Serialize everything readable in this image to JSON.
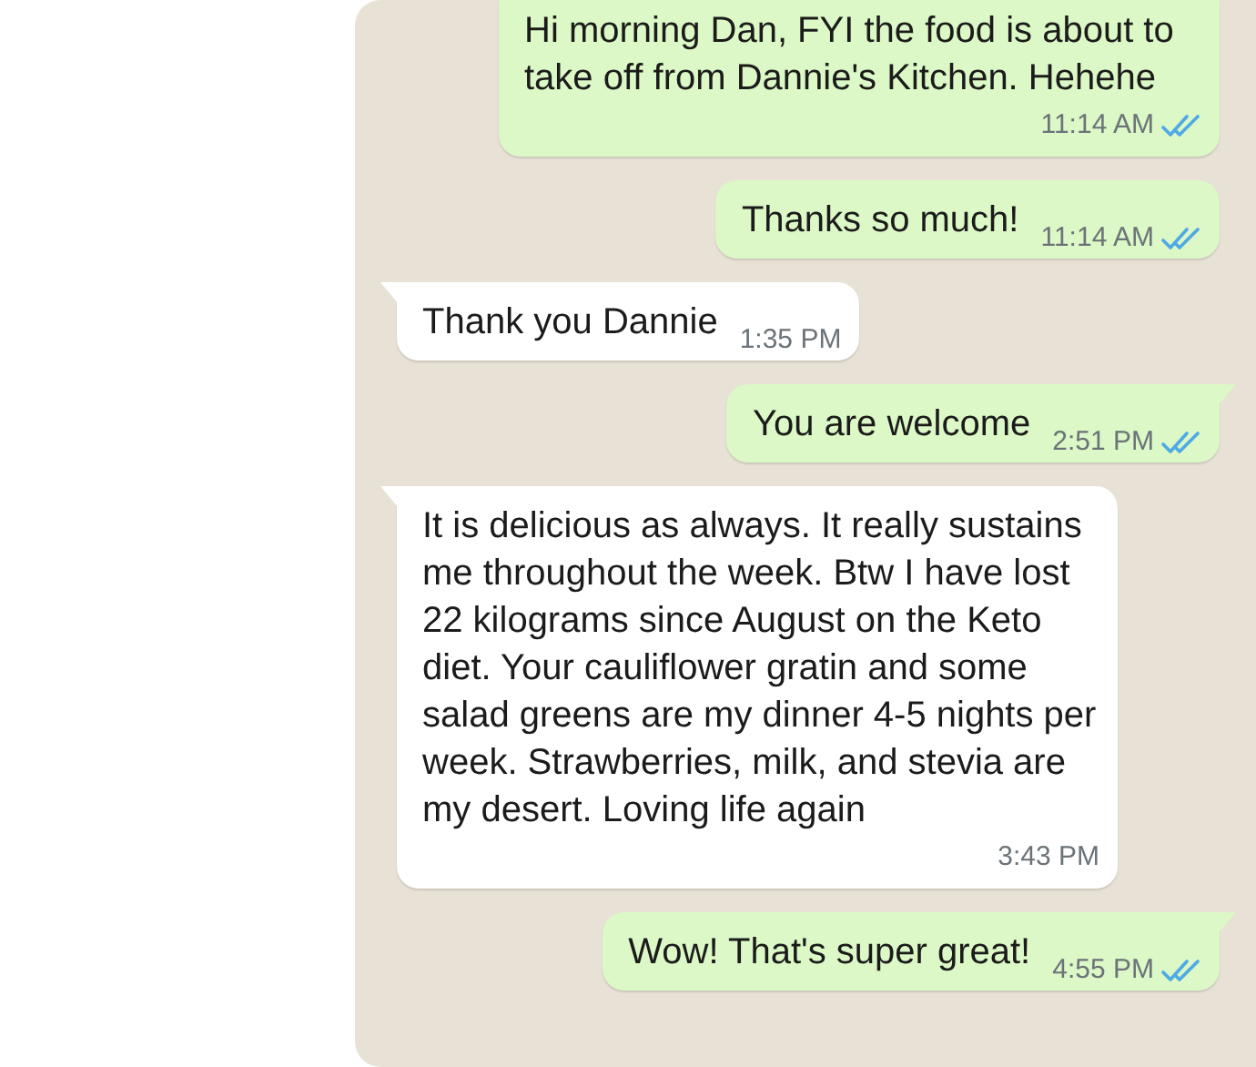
{
  "messages": [
    {
      "kind": "sent",
      "text": "Hi morning Dan, FYI the food is about to take off from Dannie's Kitchen. Hehehe",
      "time": "11:14 AM",
      "read": true,
      "tail": false
    },
    {
      "kind": "sent",
      "text": "Thanks so much!",
      "time": "11:14 AM",
      "read": true,
      "tail": false
    },
    {
      "kind": "received",
      "text": "Thank you Dannie",
      "time": "1:35 PM",
      "tail": true
    },
    {
      "kind": "sent",
      "text": "You are welcome",
      "time": "2:51 PM",
      "read": true,
      "tail": true
    },
    {
      "kind": "received",
      "text": "It is delicious as always. It really sustains me throughout the week. Btw I have lost 22 kilograms since August on the Keto diet. Your cauliflower gratin and some salad greens are my dinner 4-5 nights per week. Strawberries, milk, and stevia are my desert. Loving life again",
      "time": "3:43 PM",
      "tail": true
    },
    {
      "kind": "sent",
      "text": "Wow! That's super great!",
      "time": "4:55 PM",
      "read": true,
      "tail": true
    }
  ]
}
